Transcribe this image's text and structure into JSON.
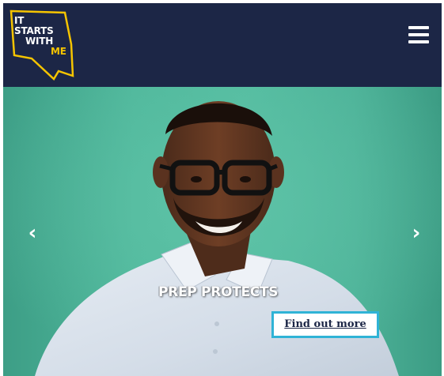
{
  "header": {
    "logo": {
      "line1": "IT",
      "line2": "STARTS",
      "line3": "WITH",
      "line4": "ME",
      "accent_color": "#f5c400",
      "icon": "it-starts-with-me-logo"
    },
    "menu_icon": "hamburger-menu-icon",
    "background_color": "#1c2646"
  },
  "hero": {
    "background_color": "#4fb79b",
    "prev_icon": "chevron-left-icon",
    "prev_label": "‹",
    "next_icon": "chevron-right-icon",
    "next_label": "›",
    "title": "PREP PROTECTS",
    "cta_label": "Find out more",
    "cta_border_color": "#2fb3d6"
  }
}
